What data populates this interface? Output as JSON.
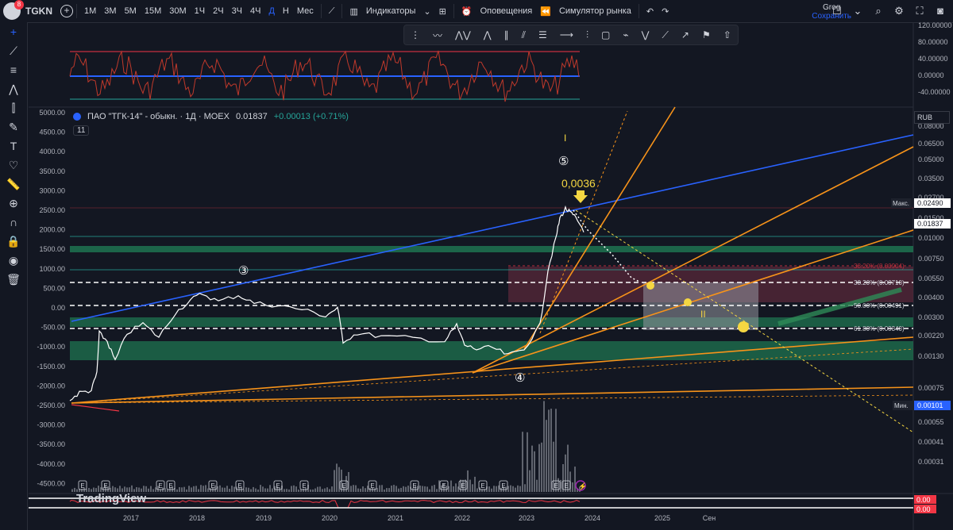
{
  "header": {
    "ticker": "TGKN",
    "badge": "8",
    "timeframes": [
      "1М",
      "3М",
      "5М",
      "15М",
      "30М",
      "1Ч",
      "2Ч",
      "3Ч",
      "4Ч",
      "Д",
      "Н",
      "Мес"
    ],
    "active_timeframe": "Д",
    "indicators_label": "Индикаторы",
    "alerts_label": "Оповещения",
    "replay_label": "Симулятор рынка",
    "user_name": "Grog",
    "save_label": "Сохранить"
  },
  "legend": {
    "title": "ПАО \"ТГК-14\" - обыкн. · 1Д · MOEX",
    "price": "0.01837",
    "change": "+0.00013 (+0.71%)",
    "sub_value": "11"
  },
  "currency": "RUB",
  "annotations": {
    "wave3": "③",
    "wave4": "④",
    "wave5": "⑤",
    "roman1": "I",
    "roman2": "II",
    "peak_label": "0,0036"
  },
  "fib_levels": [
    {
      "label": "38.20% (0.00904)"
    },
    {
      "label": "38.20% (0.00710)"
    },
    {
      "label": "50.00% (0.00491)"
    },
    {
      "label": "61.80% (0.00340)"
    }
  ],
  "max_label": "Макс.",
  "min_label": "Мин.",
  "max_value": "0.02490",
  "min_value": "0.00101",
  "last_price": "0.01837",
  "osc_axis": [
    "120.00000",
    "80.00000",
    "40.00000",
    "0.00000",
    "-40.00000"
  ],
  "left_axis": [
    "5000.00",
    "4500.00",
    "4000.00",
    "3500.00",
    "3000.00",
    "2500.00",
    "2000.00",
    "1500.00",
    "1000.00",
    "500.00",
    "0.00",
    "-500.00",
    "-1000.00",
    "-1500.00",
    "-2000.00",
    "-2500.00",
    "-3000.00",
    "-3500.00",
    "-4000.00",
    "-4500.00"
  ],
  "right_axis": [
    "0.08000",
    "0.06500",
    "0.05000",
    "0.03500",
    "0.02700",
    "0.01500",
    "0.01000",
    "0.00750",
    "0.00550",
    "0.00400",
    "0.00300",
    "0.00220",
    "0.00130",
    "0.00075",
    "0.00055",
    "0.00041",
    "0.00031"
  ],
  "x_axis": [
    "2017",
    "2018",
    "2019",
    "2020",
    "2021",
    "2022",
    "2023",
    "2024",
    "2025",
    "Сен"
  ],
  "bottom_values": [
    "0.00",
    "0.00"
  ],
  "branding": "TradingView",
  "colors": {
    "bg": "#131722",
    "accent": "#2962ff",
    "orange": "#f7931a",
    "green_zone": "#1e6e4e",
    "pink_zone": "#5c2a3a",
    "yellow": "#f5d742"
  }
}
